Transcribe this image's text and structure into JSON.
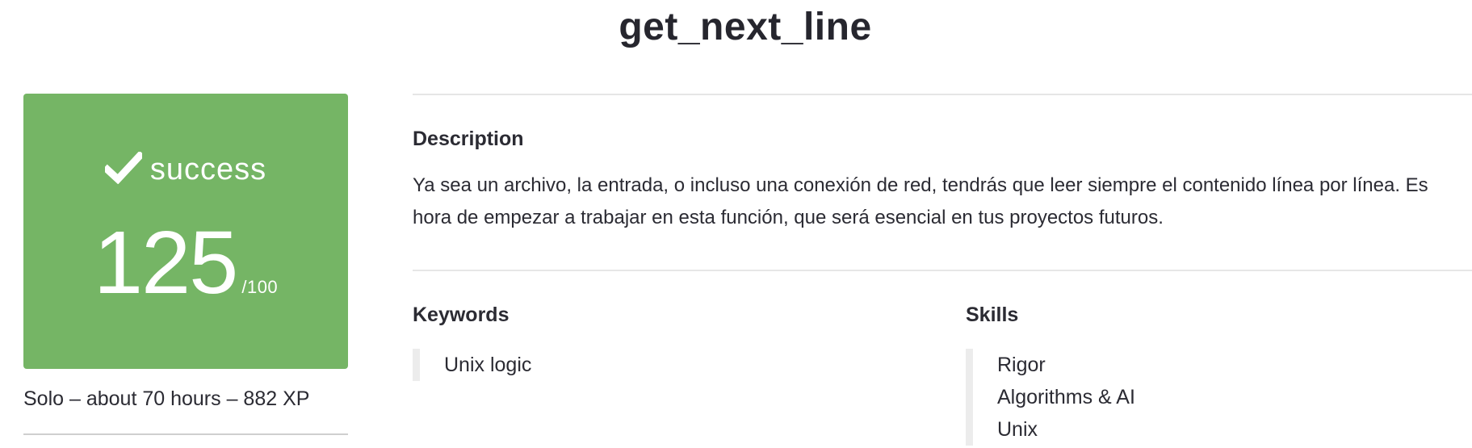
{
  "project": {
    "title": "get_next_line"
  },
  "score_card": {
    "status_icon": "checkmark-icon",
    "status": "success",
    "grade": "125",
    "grade_max": "/100",
    "color": "#75b565"
  },
  "meta": {
    "summary": "Solo – about 70 hours – 882 XP"
  },
  "description": {
    "heading": "Description",
    "text": "Ya sea un archivo, la entrada, o incluso una conexión de red, tendrás que leer siempre el contenido línea por línea. Es hora de empezar a trabajar en esta función, que será esencial en tus proyectos futuros."
  },
  "keywords": {
    "heading": "Keywords",
    "items": [
      "Unix logic"
    ]
  },
  "skills": {
    "heading": "Skills",
    "items": [
      "Rigor",
      "Algorithms & AI",
      "Unix"
    ]
  }
}
